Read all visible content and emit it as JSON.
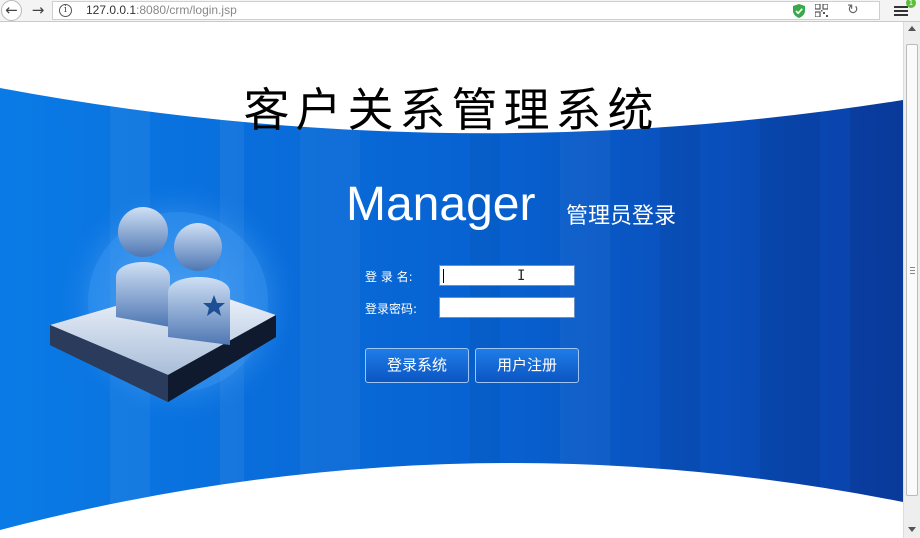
{
  "browser": {
    "url_host": "127.0.0.1",
    "url_rest": ":8080/crm/login.jsp",
    "badge_count": "1",
    "icons": [
      "back-arrow-icon",
      "forward-arrow-icon",
      "info-icon",
      "shield-icon",
      "qr-code-icon",
      "reload-icon",
      "menu-icon"
    ]
  },
  "page": {
    "title": "客户关系管理系统",
    "manager_title": "Manager",
    "manager_subtitle": "管理员登录"
  },
  "form": {
    "username_label": "登 录 名:",
    "password_label": "登录密码:",
    "username_value": "",
    "password_value": "",
    "login_button": "登录系统",
    "register_button": "用户注册"
  },
  "colors": {
    "banner_dark": "#0a3fa8",
    "banner_light": "#0a7be6",
    "button": "#0b55c2"
  }
}
